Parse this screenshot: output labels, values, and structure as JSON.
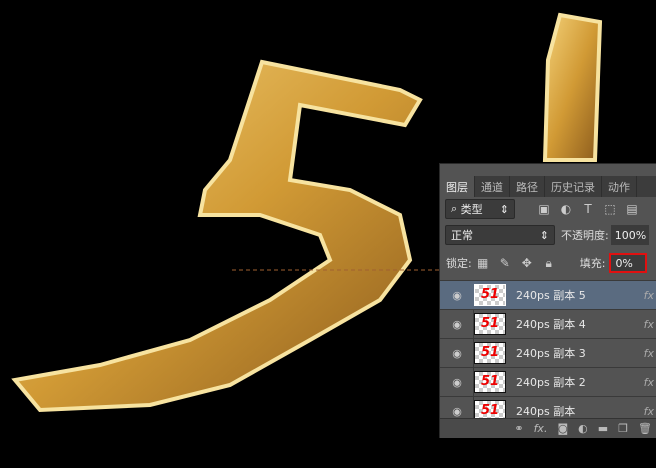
{
  "panel": {
    "tabs": [
      "图层",
      "通道",
      "路径",
      "历史记录",
      "动作"
    ],
    "filter": {
      "label": "类型",
      "icons": [
        "image-filter-icon",
        "adjustment-filter-icon",
        "type-filter-icon",
        "shape-filter-icon",
        "smart-object-filter-icon"
      ]
    },
    "blend_mode": "正常",
    "opacity_label": "不透明度:",
    "opacity_value": "100%",
    "lock_label": "锁定:",
    "fill_label": "填充:",
    "fill_value": "0%",
    "layers": [
      {
        "name": "240ps 副本 5",
        "thumb": "51",
        "selected": true
      },
      {
        "name": "240ps 副本 4",
        "thumb": "51"
      },
      {
        "name": "240ps 副本 3",
        "thumb": "51"
      },
      {
        "name": "240ps 副本 2",
        "thumb": "51"
      },
      {
        "name": "240ps 副本",
        "thumb": "51"
      }
    ],
    "fx_label": "fx"
  },
  "colors": {
    "highlight": "#e01010",
    "gold": "#d9a63a"
  }
}
